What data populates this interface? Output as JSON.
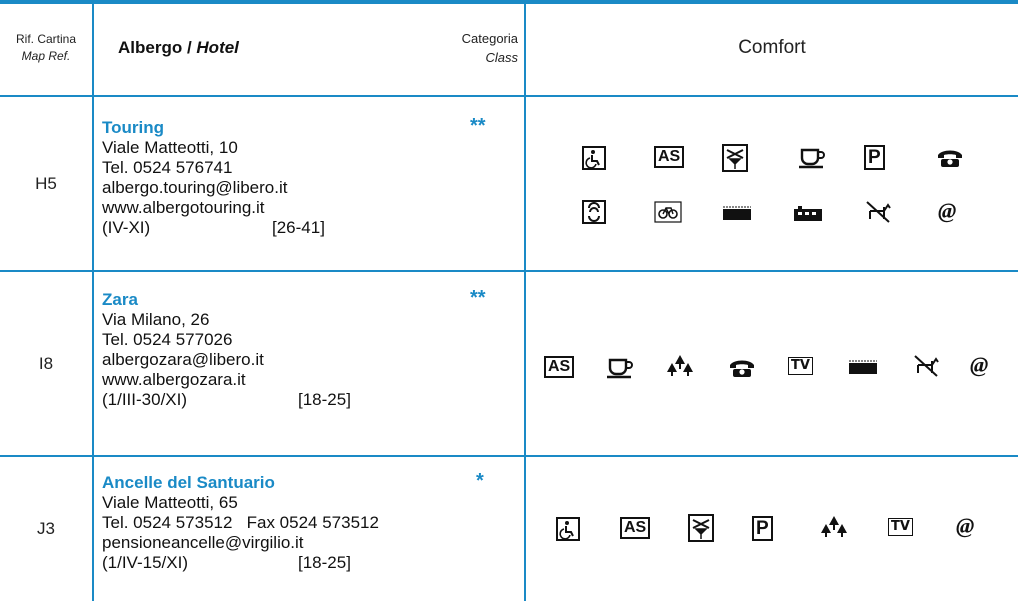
{
  "header": {
    "ref_label": "Rif. Cartina",
    "ref_label_en": "Map Ref.",
    "hotel_label": "Albergo / ",
    "hotel_label_en": "Hotel",
    "class_label": "Categoria",
    "class_label_en": "Class",
    "comfort_label": "Comfort"
  },
  "rows": [
    {
      "ref": "H5",
      "name": "Touring",
      "stars": "**",
      "address": "Viale Matteotti, 10",
      "phone": "Tel. 0524 576741",
      "email": "albergo.touring@libero.it",
      "web": "www.albergotouring.it",
      "period": "(IV-XI)",
      "price": "[26-41]",
      "icons_row1": [
        "wheelchair-icon",
        "as-icon",
        "restaurant-icon",
        "cup-icon",
        "parking-icon",
        "phone-icon"
      ],
      "icons_row2": [
        "spa-icon",
        "bicycle-icon",
        "landscape-icon",
        "train-icon",
        "pets-icon",
        "at-icon"
      ]
    },
    {
      "ref": "I8",
      "name": "Zara",
      "stars": "**",
      "address": "Via Milano, 26",
      "phone": "Tel. 0524 577026",
      "email": "albergozara@libero.it",
      "web": "www.albergozara.it",
      "period": "(1/III-30/XI)",
      "price": "[18-25]",
      "icons_row1": [
        "as-icon",
        "cup-icon",
        "trees-icon",
        "phone-icon",
        "tv-icon",
        "landscape-icon",
        "pets-icon",
        "at-icon"
      ]
    },
    {
      "ref": "J3",
      "name": "Ancelle del Santuario",
      "stars": "*",
      "address": "Viale Matteotti, 65",
      "phone": "Tel. 0524 573512   Fax 0524 573512",
      "email": "pensioneancelle@virgilio.it",
      "period": "(1/IV-15/XI)",
      "price": "[18-25]",
      "icons_row1": [
        "wheelchair-icon",
        "as-icon",
        "restaurant-icon",
        "parking-icon",
        "trees-icon",
        "tv-icon",
        "at-icon"
      ]
    }
  ],
  "icon_text": {
    "as": "AS",
    "parking": "P",
    "tv": "TV",
    "at": "@"
  }
}
